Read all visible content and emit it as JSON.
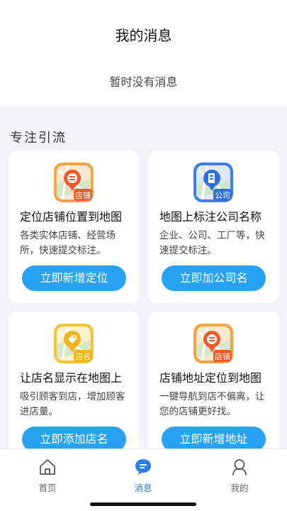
{
  "header": {
    "title": "我的消息",
    "empty_text": "暂时没有消息"
  },
  "section": {
    "title": "专注引流"
  },
  "cards": [
    {
      "icon": "shop-pin-icon",
      "badge": "店铺",
      "title": "定位店铺位置到地图",
      "desc": "各类实体店铺、经营场所，快速提交标注。",
      "button": "立即新增定位"
    },
    {
      "icon": "company-building-icon",
      "badge": "公司",
      "title": "地图上标注公司名称",
      "desc": "企业、公司、工厂等，快速提交标注。",
      "button": "立即加公司名"
    },
    {
      "icon": "shop-name-tag-icon",
      "badge": "店名",
      "title": "让店名显示在地图上",
      "desc": "吸引顾客到店，增加顾客进店量。",
      "button": "立即添加店名"
    },
    {
      "icon": "shop-address-pin-icon",
      "badge": "店铺",
      "title": "店铺地址定位到地图",
      "desc": "一键导航到店不偏离，让您的店铺更好找。",
      "button": "立即新增地址"
    }
  ],
  "tabbar": {
    "items": [
      {
        "label": "首页",
        "icon": "home-icon",
        "active": false
      },
      {
        "label": "消息",
        "icon": "message-icon",
        "active": true
      },
      {
        "label": "我的",
        "icon": "profile-icon",
        "active": false
      }
    ]
  },
  "colors": {
    "accent": "#27a3f2",
    "tab_active": "#2a7de1",
    "orange": "#f4a23b",
    "blue": "#3d7ef2",
    "yellow": "#f7c93b"
  }
}
